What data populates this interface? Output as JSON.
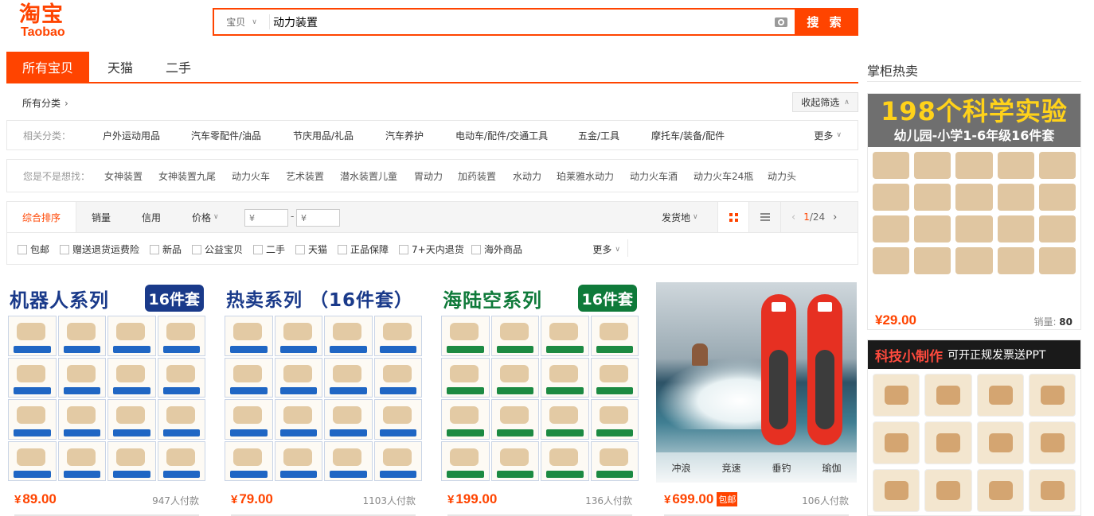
{
  "logo": {
    "cn": "淘宝",
    "en": "Taobao"
  },
  "search": {
    "type_label": "宝贝",
    "query": "动力装置",
    "button": "搜 索"
  },
  "tabs": [
    "所有宝贝",
    "天猫",
    "二手"
  ],
  "crumb": {
    "label": "所有分类",
    "chevron": "›"
  },
  "collapse": {
    "label": "收起筛选",
    "icon": "chevron-up-icon"
  },
  "related": {
    "label": "相关分类：",
    "items": [
      "户外运动用品",
      "汽车零配件/油品",
      "节庆用品/礼品",
      "汽车养护",
      "电动车/配件/交通工具",
      "五金/工具",
      "摩托车/装备/配件"
    ],
    "more": "更多"
  },
  "suggest": {
    "label": "您是不是想找：",
    "items": [
      "女神装置",
      "女神装置九尾",
      "动力火车",
      "艺术装置",
      "潜水装置儿童",
      "胃动力",
      "加药装置",
      "水动力",
      "珀莱雅水动力",
      "动力火车酒",
      "动力火车24瓶",
      "动力头"
    ]
  },
  "sort": {
    "active": "综合排序",
    "items": [
      "销量",
      "信用",
      "价格"
    ],
    "price_from_placeholder": "¥",
    "price_to_placeholder": "¥",
    "dash": "-",
    "location": "发货地",
    "page_current": "1",
    "page_total": "/24"
  },
  "checks": {
    "items": [
      "包邮",
      "赠送退货运费险",
      "新品",
      "公益宝贝",
      "二手",
      "天猫",
      "正品保障",
      "7+天内退货",
      "海外商品"
    ],
    "more": "更多"
  },
  "products": [
    {
      "banner": "机器人系列",
      "badge": "16件套",
      "price": "89.00",
      "paid": "947人付款"
    },
    {
      "banner": "热卖系列 （16件套）",
      "badge": "",
      "price": "79.00",
      "paid": "1103人付款"
    },
    {
      "banner": "海陆空系列",
      "badge": "16件套",
      "price": "199.00",
      "paid": "136人付款"
    },
    {
      "banner": "",
      "badge": "",
      "price": "699.00",
      "paid": "106人付款",
      "tag": "包邮",
      "photo_tags": [
        "冲浪",
        "竞速",
        "垂钓",
        "瑜伽"
      ]
    }
  ],
  "sidebar": {
    "title": "掌柜热卖",
    "ad1": {
      "headline": "198个科学实验",
      "subline": "幼儿园-小学1-6年级16件套",
      "price": "29.00",
      "sold_label": "销量: ",
      "sold": "80"
    },
    "ad2": {
      "headline": "科技小制作",
      "subline": "可开正规发票送PPT"
    }
  },
  "currency": "¥",
  "colors": {
    "accent": "#ff4400",
    "robot_banner": "#1a3a8a",
    "sea_banner": "#0f7a3a"
  }
}
